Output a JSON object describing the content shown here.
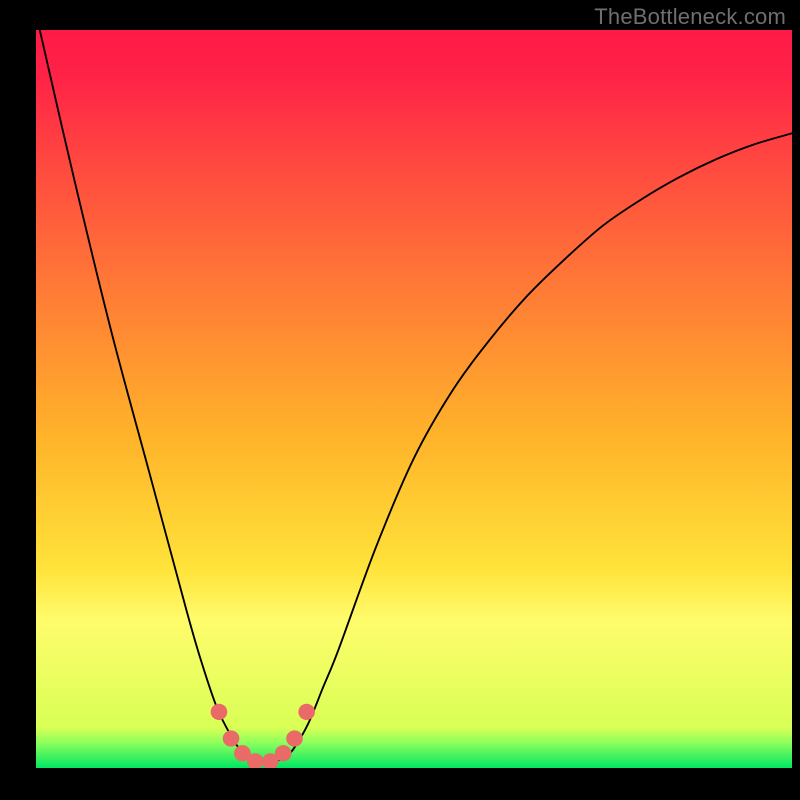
{
  "watermark": "TheBottleneck.com",
  "chart_data": {
    "type": "line",
    "title": "",
    "xlabel": "",
    "ylabel": "",
    "xlim": [
      0,
      100
    ],
    "ylim": [
      0,
      100
    ],
    "series": [
      {
        "name": "curve",
        "x": [
          0.5,
          5,
          10,
          15,
          20,
          22,
          24,
          26,
          27,
          28,
          29,
          30,
          31,
          32,
          33,
          34,
          36,
          38,
          40,
          45,
          50,
          55,
          60,
          65,
          70,
          75,
          80,
          85,
          90,
          95,
          100
        ],
        "y": [
          100,
          80,
          59,
          40,
          21,
          14,
          8,
          4,
          2.5,
          1.6,
          1.0,
          0.7,
          0.7,
          1.0,
          1.6,
          2.5,
          6,
          11,
          16,
          30,
          42,
          51,
          58,
          64,
          69,
          73.5,
          77,
          80,
          82.5,
          84.5,
          86
        ]
      }
    ],
    "markers": {
      "name": "trough-markers",
      "color": "#ea6a68",
      "radius_pct": 1.1,
      "points": [
        {
          "x": 24.2,
          "y": 7.6
        },
        {
          "x": 25.8,
          "y": 4.0
        },
        {
          "x": 27.3,
          "y": 2.0
        },
        {
          "x": 29.0,
          "y": 0.9
        },
        {
          "x": 31.0,
          "y": 0.9
        },
        {
          "x": 32.7,
          "y": 2.0
        },
        {
          "x": 34.2,
          "y": 4.0
        },
        {
          "x": 35.8,
          "y": 7.6
        }
      ]
    },
    "bands": [
      {
        "name": "pale-band",
        "y0": 20.5,
        "y1": 27.0,
        "color": "#ffffa1"
      },
      {
        "name": "yellow-band",
        "y0": 5.5,
        "y1": 20.5,
        "color_top": "#ffff6a",
        "color_bottom": "#e7ff54"
      },
      {
        "name": "green-band",
        "y0": 0.0,
        "y1": 5.5,
        "color_top": "#8fff5c",
        "color_bottom": "#00e763"
      }
    ],
    "gradient_stops": [
      {
        "offset": 0.0,
        "color": "#ff1a47"
      },
      {
        "offset": 0.06,
        "color": "#ff2247"
      },
      {
        "offset": 0.18,
        "color": "#ff4840"
      },
      {
        "offset": 0.35,
        "color": "#ff7a36"
      },
      {
        "offset": 0.55,
        "color": "#ffb32a"
      },
      {
        "offset": 0.73,
        "color": "#ffe33a"
      },
      {
        "offset": 0.8,
        "color": "#fffc6c"
      },
      {
        "offset": 0.945,
        "color": "#d9ff55"
      },
      {
        "offset": 0.965,
        "color": "#90ff5c"
      },
      {
        "offset": 1.0,
        "color": "#00e763"
      }
    ]
  }
}
